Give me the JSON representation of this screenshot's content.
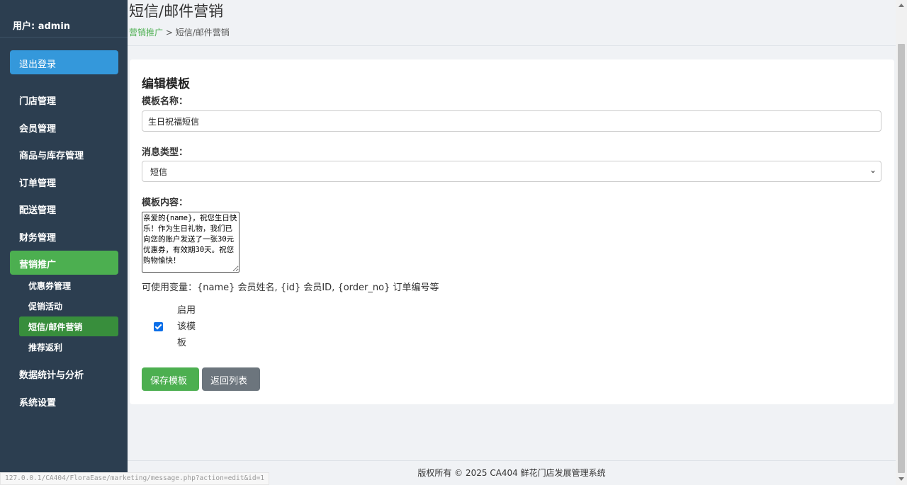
{
  "sidebar": {
    "user": "用户: admin",
    "logout": "退出登录",
    "items": [
      {
        "label": "门店管理"
      },
      {
        "label": "会员管理"
      },
      {
        "label": "商品与库存管理"
      },
      {
        "label": "订单管理"
      },
      {
        "label": "配送管理"
      },
      {
        "label": "财务管理"
      },
      {
        "label": "营销推广",
        "active": true
      },
      {
        "label": "数据统计与分析"
      },
      {
        "label": "系统设置"
      }
    ],
    "sub_items": [
      {
        "label": "优惠券管理"
      },
      {
        "label": "促销活动"
      },
      {
        "label": "短信/邮件营销",
        "active": true
      },
      {
        "label": "推荐返利"
      }
    ]
  },
  "header": {
    "title": "短信/邮件营销",
    "breadcrumb_link": "营销推广",
    "breadcrumb_sep": " > ",
    "breadcrumb_current": "短信/邮件营销"
  },
  "form": {
    "title": "编辑模板",
    "name_label": "模板名称：",
    "name_value": "生日祝福短信",
    "type_label": "消息类型：",
    "type_value": "短信",
    "content_label": "模板内容：",
    "content_value": "亲爱的{name}，祝您生日快乐！作为生日礼物，我们已向您的账户发送了一张30元优惠券，有效期30天。祝您购物愉快！",
    "hint": "可使用变量：{name} 会员姓名, {id} 会员ID, {order_no} 订单编号等",
    "enable_label": "启用该模板",
    "enable_checked": true,
    "save_label": "保存模板",
    "back_label": "返回列表"
  },
  "footer": {
    "text": "版权所有 © 2025 CA404 鲜花门店发展管理系统"
  },
  "status_url": "127.0.0.1/CA404/FloraEase/marketing/message.php?action=edit&id=1",
  "colors": {
    "sidebar_bg": "#2c3e50",
    "logout_bg": "#3498db",
    "active_green": "#4caf50",
    "sub_active_green": "#388e3c",
    "back_button": "#6c757d",
    "checkbox": "#0b6ee8"
  }
}
